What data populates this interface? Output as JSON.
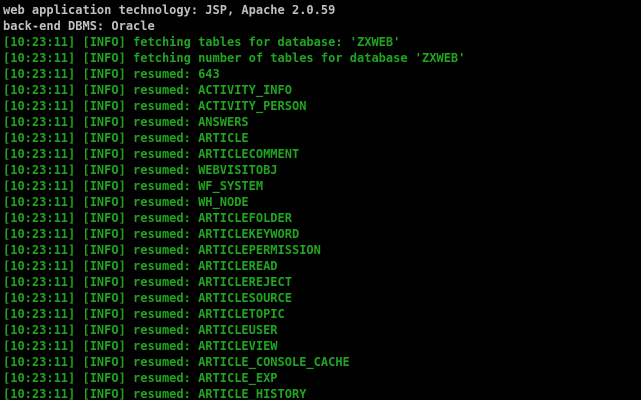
{
  "colors": {
    "background": "#000000",
    "header_text": "#c0c0c0",
    "log_text": "#1fa51f"
  },
  "terminal": {
    "lines": [
      {
        "text": "web application technology: JSP, Apache 2.0.59",
        "style": "white"
      },
      {
        "text": "back-end DBMS: Oracle",
        "style": "white"
      },
      {
        "text": "[10:23:11] [INFO] fetching tables for database: 'ZXWEB'",
        "style": "green"
      },
      {
        "text": "[10:23:11] [INFO] fetching number of tables for database 'ZXWEB'",
        "style": "green"
      },
      {
        "text": "[10:23:11] [INFO] resumed: 643",
        "style": "green"
      },
      {
        "text": "[10:23:11] [INFO] resumed: ACTIVITY_INFO",
        "style": "green"
      },
      {
        "text": "[10:23:11] [INFO] resumed: ACTIVITY_PERSON",
        "style": "green"
      },
      {
        "text": "[10:23:11] [INFO] resumed: ANSWERS",
        "style": "green"
      },
      {
        "text": "[10:23:11] [INFO] resumed: ARTICLE",
        "style": "green"
      },
      {
        "text": "[10:23:11] [INFO] resumed: ARTICLECOMMENT",
        "style": "green"
      },
      {
        "text": "[10:23:11] [INFO] resumed: WEBVISITOBJ",
        "style": "green"
      },
      {
        "text": "[10:23:11] [INFO] resumed: WF_SYSTEM",
        "style": "green"
      },
      {
        "text": "[10:23:11] [INFO] resumed: WH_NODE",
        "style": "green"
      },
      {
        "text": "[10:23:11] [INFO] resumed: ARTICLEFOLDER",
        "style": "green"
      },
      {
        "text": "[10:23:11] [INFO] resumed: ARTICLEKEYWORD",
        "style": "green"
      },
      {
        "text": "[10:23:11] [INFO] resumed: ARTICLEPERMISSION",
        "style": "green"
      },
      {
        "text": "[10:23:11] [INFO] resumed: ARTICLEREAD",
        "style": "green"
      },
      {
        "text": "[10:23:11] [INFO] resumed: ARTICLEREJECT",
        "style": "green"
      },
      {
        "text": "[10:23:11] [INFO] resumed: ARTICLESOURCE",
        "style": "green"
      },
      {
        "text": "[10:23:11] [INFO] resumed: ARTICLETOPIC",
        "style": "green"
      },
      {
        "text": "[10:23:11] [INFO] resumed: ARTICLEUSER",
        "style": "green"
      },
      {
        "text": "[10:23:11] [INFO] resumed: ARTICLEVIEW",
        "style": "green"
      },
      {
        "text": "[10:23:11] [INFO] resumed: ARTICLE_CONSOLE_CACHE",
        "style": "green"
      },
      {
        "text": "[10:23:11] [INFO] resumed: ARTICLE_EXP",
        "style": "green"
      },
      {
        "text": "[10:23:11] [INFO] resumed: ARTICLE_HISTORY",
        "style": "green"
      }
    ]
  }
}
